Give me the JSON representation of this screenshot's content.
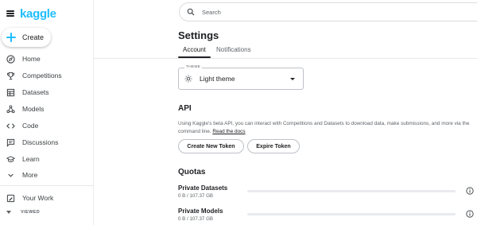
{
  "brand": {
    "logo_text": "kaggle",
    "accent_color": "#20beff"
  },
  "sidebar": {
    "create_label": "Create",
    "items": [
      {
        "label": "Home",
        "icon": "home-icon"
      },
      {
        "label": "Competitions",
        "icon": "trophy-icon"
      },
      {
        "label": "Datasets",
        "icon": "table-icon"
      },
      {
        "label": "Models",
        "icon": "models-icon"
      },
      {
        "label": "Code",
        "icon": "code-icon"
      },
      {
        "label": "Discussions",
        "icon": "comments-icon"
      },
      {
        "label": "Learn",
        "icon": "school-icon"
      },
      {
        "label": "More",
        "icon": "chevron-down-icon"
      }
    ],
    "your_work_label": "Your Work",
    "viewed_label": "VIEWED"
  },
  "search": {
    "placeholder": "Search"
  },
  "settings": {
    "title": "Settings",
    "tabs": [
      {
        "label": "Account",
        "active": true
      },
      {
        "label": "Notifications",
        "active": false
      }
    ],
    "theme": {
      "tag": "THEME",
      "value": "Light theme"
    },
    "api": {
      "heading": "API",
      "description": "Using Kaggle's beta API, you can interact with Competitions and Datasets to download data, make submissions, and more via the command line.",
      "docs_link": "Read the docs",
      "create_token_label": "Create New Token",
      "expire_token_label": "Expire Token"
    },
    "quotas": {
      "heading": "Quotas",
      "items": [
        {
          "label": "Private Datasets",
          "value": "0 B / 107.37 GB",
          "fraction_used": 0
        },
        {
          "label": "Private Models",
          "value": "0 B / 107.37 GB",
          "fraction_used": 0
        }
      ]
    }
  }
}
